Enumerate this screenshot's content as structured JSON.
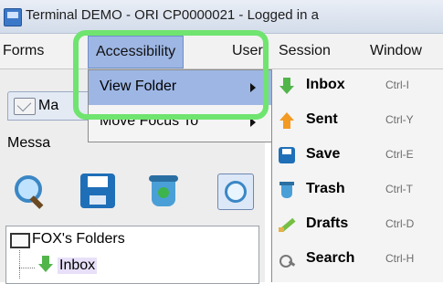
{
  "window": {
    "title": "Terminal DEMO - ORI CP0000021 - Logged in a"
  },
  "menubar": {
    "items": [
      {
        "label": "Forms",
        "mnemonic": "F"
      },
      {
        "label": "Accessibility",
        "mnemonic": "A"
      },
      {
        "label": "User",
        "mnemonic": "U"
      },
      {
        "label": "Session",
        "mnemonic": "S"
      },
      {
        "label": "Window",
        "mnemonic": "W"
      }
    ]
  },
  "accessibility_menu": {
    "items": [
      {
        "label": "View Folder"
      },
      {
        "label": "Move Focus To"
      }
    ]
  },
  "view_folder_submenu": {
    "items": [
      {
        "label": "Inbox",
        "shortcut": "Ctrl-I",
        "icon": "inbox-arrow-icon"
      },
      {
        "label": "Sent",
        "shortcut": "Ctrl-Y",
        "icon": "sent-arrow-icon"
      },
      {
        "label": "Save",
        "shortcut": "Ctrl-E",
        "icon": "save-icon"
      },
      {
        "label": "Trash",
        "shortcut": "Ctrl-T",
        "icon": "trash-icon"
      },
      {
        "label": "Drafts",
        "shortcut": "Ctrl-D",
        "icon": "drafts-icon"
      },
      {
        "label": "Search",
        "shortcut": "Ctrl-H",
        "icon": "search-icon"
      }
    ]
  },
  "left_pane": {
    "mail_tab_label": "Ma",
    "messages_label": "Messa"
  },
  "folders": {
    "root_label": "FOX's Folders",
    "items": [
      {
        "label": "Inbox"
      }
    ]
  },
  "colors": {
    "highlight": "#9db6e4",
    "focus_ring": "#6fe46f"
  }
}
